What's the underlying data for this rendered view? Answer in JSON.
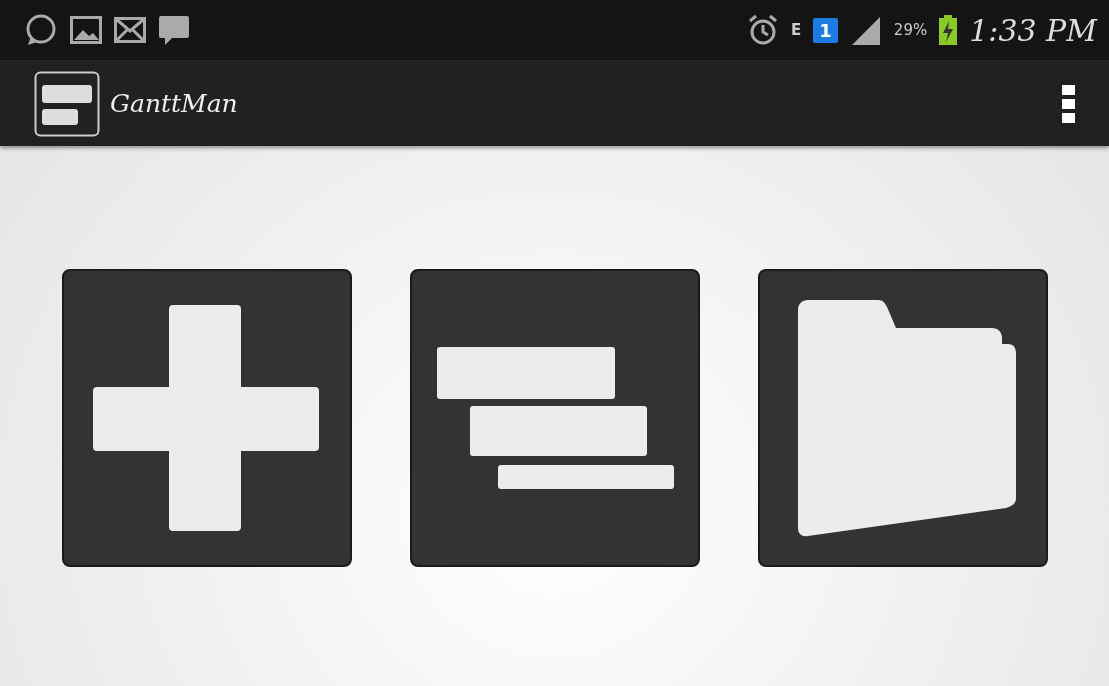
{
  "status_bar": {
    "network": "E",
    "sim": "1",
    "battery": "29%",
    "time": "1:33 PM"
  },
  "app_bar": {
    "title": "GanttMan"
  },
  "tiles": [
    {
      "kind": "plus"
    },
    {
      "kind": "gantt"
    },
    {
      "kind": "folder"
    }
  ]
}
